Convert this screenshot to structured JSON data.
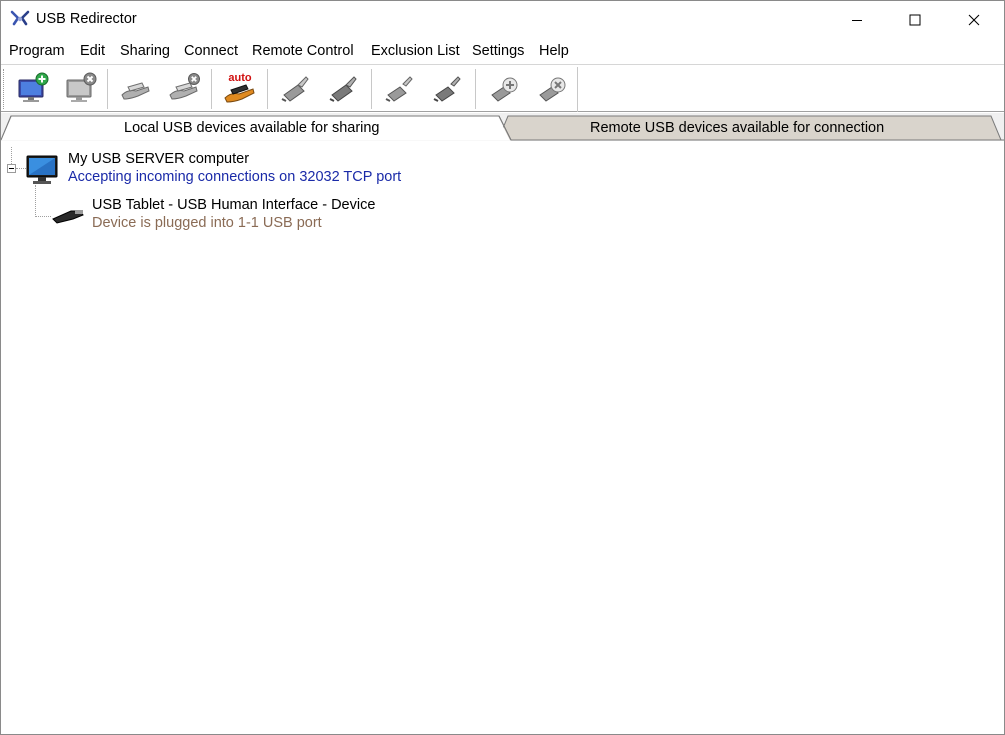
{
  "window": {
    "title": "USB Redirector"
  },
  "menu": [
    {
      "label": "Program"
    },
    {
      "label": "Edit"
    },
    {
      "label": "Sharing"
    },
    {
      "label": "Connect"
    },
    {
      "label": "Remote Control"
    },
    {
      "label": "Exclusion List"
    },
    {
      "label": "Settings"
    },
    {
      "label": "Help"
    }
  ],
  "toolbar": {
    "auto_label": "auto",
    "buttons": [
      "add-computer-icon",
      "remove-computer-icon",
      "share-device-icon",
      "unshare-device-icon",
      "auto-share-icon",
      "connect-plug-icon",
      "connect-plug-alt-icon",
      "disconnect-plug-icon",
      "disconnect-plug-alt-icon",
      "add-remote-icon",
      "remove-remote-icon"
    ]
  },
  "tabs": [
    {
      "label": "Local USB devices available for sharing",
      "active": true
    },
    {
      "label": "Remote USB devices available for connection",
      "active": false
    }
  ],
  "tree": {
    "server": {
      "title": "My USB SERVER computer",
      "status": "Accepting incoming connections on 32032 TCP port"
    },
    "device": {
      "title": "USB Tablet - USB Human Interface - Device",
      "status": "Device is plugged into 1-1 USB port"
    }
  },
  "colors": {
    "status_blue": "#1a2aa8",
    "status_brown": "#8a6b55",
    "tab_inactive": "#d9d4cc"
  }
}
